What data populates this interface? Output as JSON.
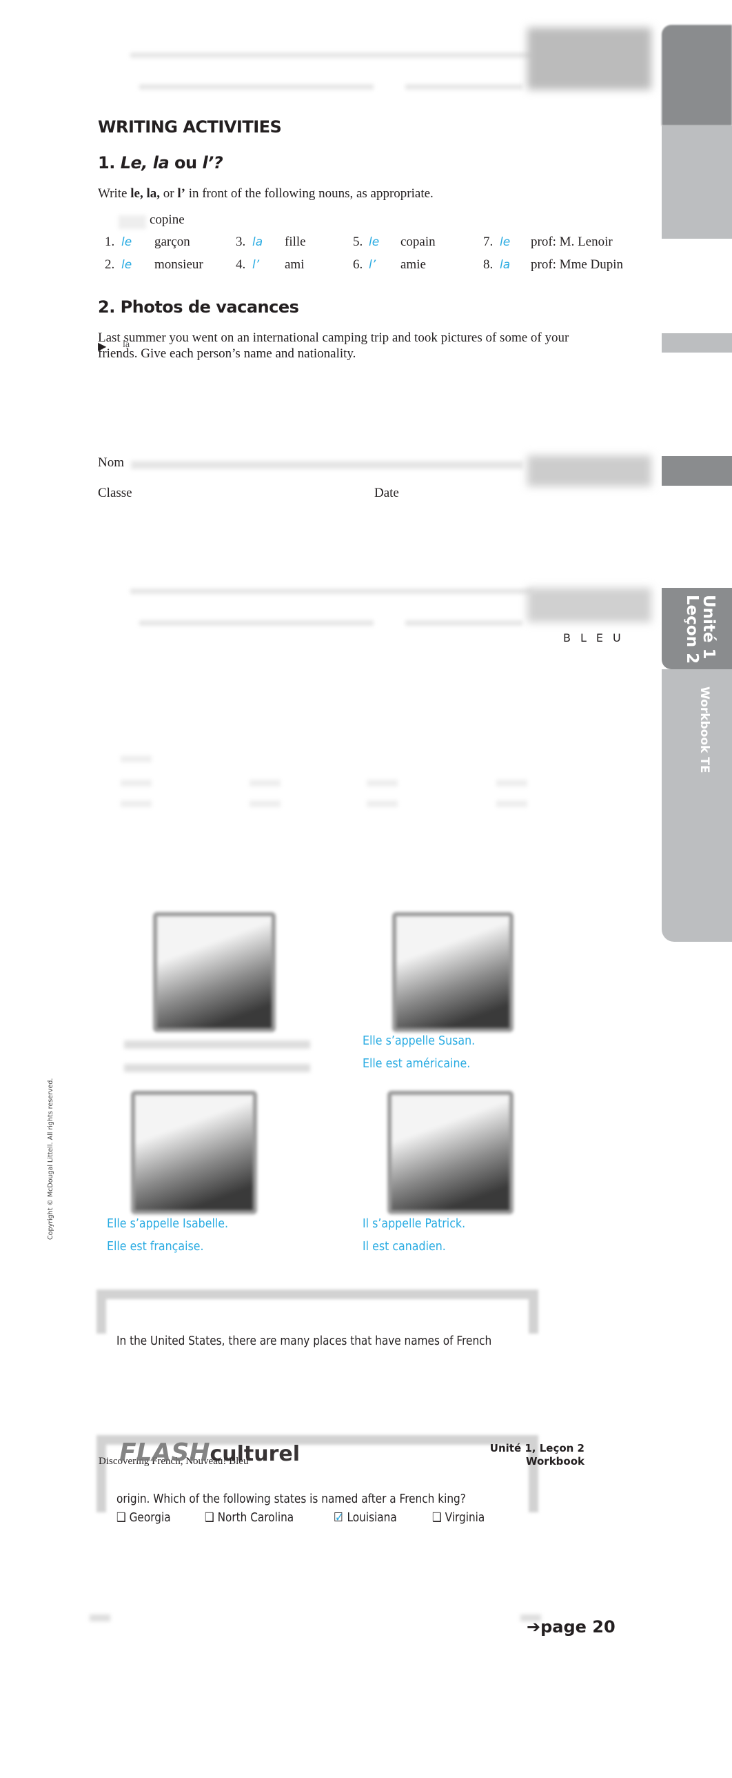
{
  "header": {
    "title": "WRITING ACTIVITIES",
    "nom_label": "Nom",
    "classe_label": "Classe",
    "date_label": "Date",
    "edition": "BLEU"
  },
  "sidebar": {
    "unit": "Unité 1",
    "lesson": "Leçon 2",
    "book": "Workbook TE"
  },
  "activity1": {
    "title_number": "1.",
    "title_le": "Le,",
    "title_la": "la",
    "title_ou": "ou",
    "title_l": "l’?",
    "instruction_pre": "Write ",
    "instruction_bold": "le, la,",
    "instruction_mid": " or ",
    "instruction_bold2": "l’",
    "instruction_post": " in front of the following nouns, as appropriate.",
    "example_noun": "copine",
    "items": [
      {
        "num": "1.",
        "answer": "le",
        "noun": "garçon"
      },
      {
        "num": "2.",
        "answer": "le",
        "noun": "monsieur"
      },
      {
        "num": "3.",
        "answer": "la",
        "noun": "fille"
      },
      {
        "num": "4.",
        "answer": "l’",
        "noun": "ami"
      },
      {
        "num": "5.",
        "answer": "le",
        "noun": "copain"
      },
      {
        "num": "6.",
        "answer": "l’",
        "noun": "amie"
      },
      {
        "num": "7.",
        "answer": "le",
        "noun": "prof: M. Lenoir"
      },
      {
        "num": "8.",
        "answer": "la",
        "noun": "prof: Mme Dupin"
      }
    ]
  },
  "activity2": {
    "title": "2. Photos de vacances",
    "line1": "Last summer you went on an international camping trip and took pictures of some of your",
    "line2": "friends. Give each person’s name and nationality.",
    "marker_text": "la",
    "answers": [
      {
        "name": "Elle s’appelle Susan.",
        "nationality": "Elle est américaine."
      },
      {
        "name": "Elle s’appelle Isabelle.",
        "nationality": "Elle est française."
      },
      {
        "name": "Il s’appelle Patrick.",
        "nationality": "Il est canadien."
      }
    ]
  },
  "flash": {
    "logo_flash": "FLASH",
    "logo_culturel": "culturel",
    "line1": "In the United States, there are many places that have names of French",
    "line2": "origin. Which of the following states is named after a French king?",
    "options": [
      {
        "label": "Georgia",
        "checked": false
      },
      {
        "label": "North Carolina",
        "checked": false
      },
      {
        "label": "Louisiana",
        "checked": true
      },
      {
        "label": "Virginia",
        "checked": false
      }
    ],
    "page_ref": "page 20"
  },
  "footer": {
    "book_title": "Discovering French, Nouveau! Bleu",
    "unit_lesson": "Unité 1, Leçon 2",
    "workbook": "Workbook"
  },
  "copyright": "Copyright © McDougal Littell. All rights reserved.",
  "colors": {
    "answer": "#29abe2",
    "sidebar_dark": "#8a8c8e",
    "sidebar_light": "#bcbec0"
  }
}
